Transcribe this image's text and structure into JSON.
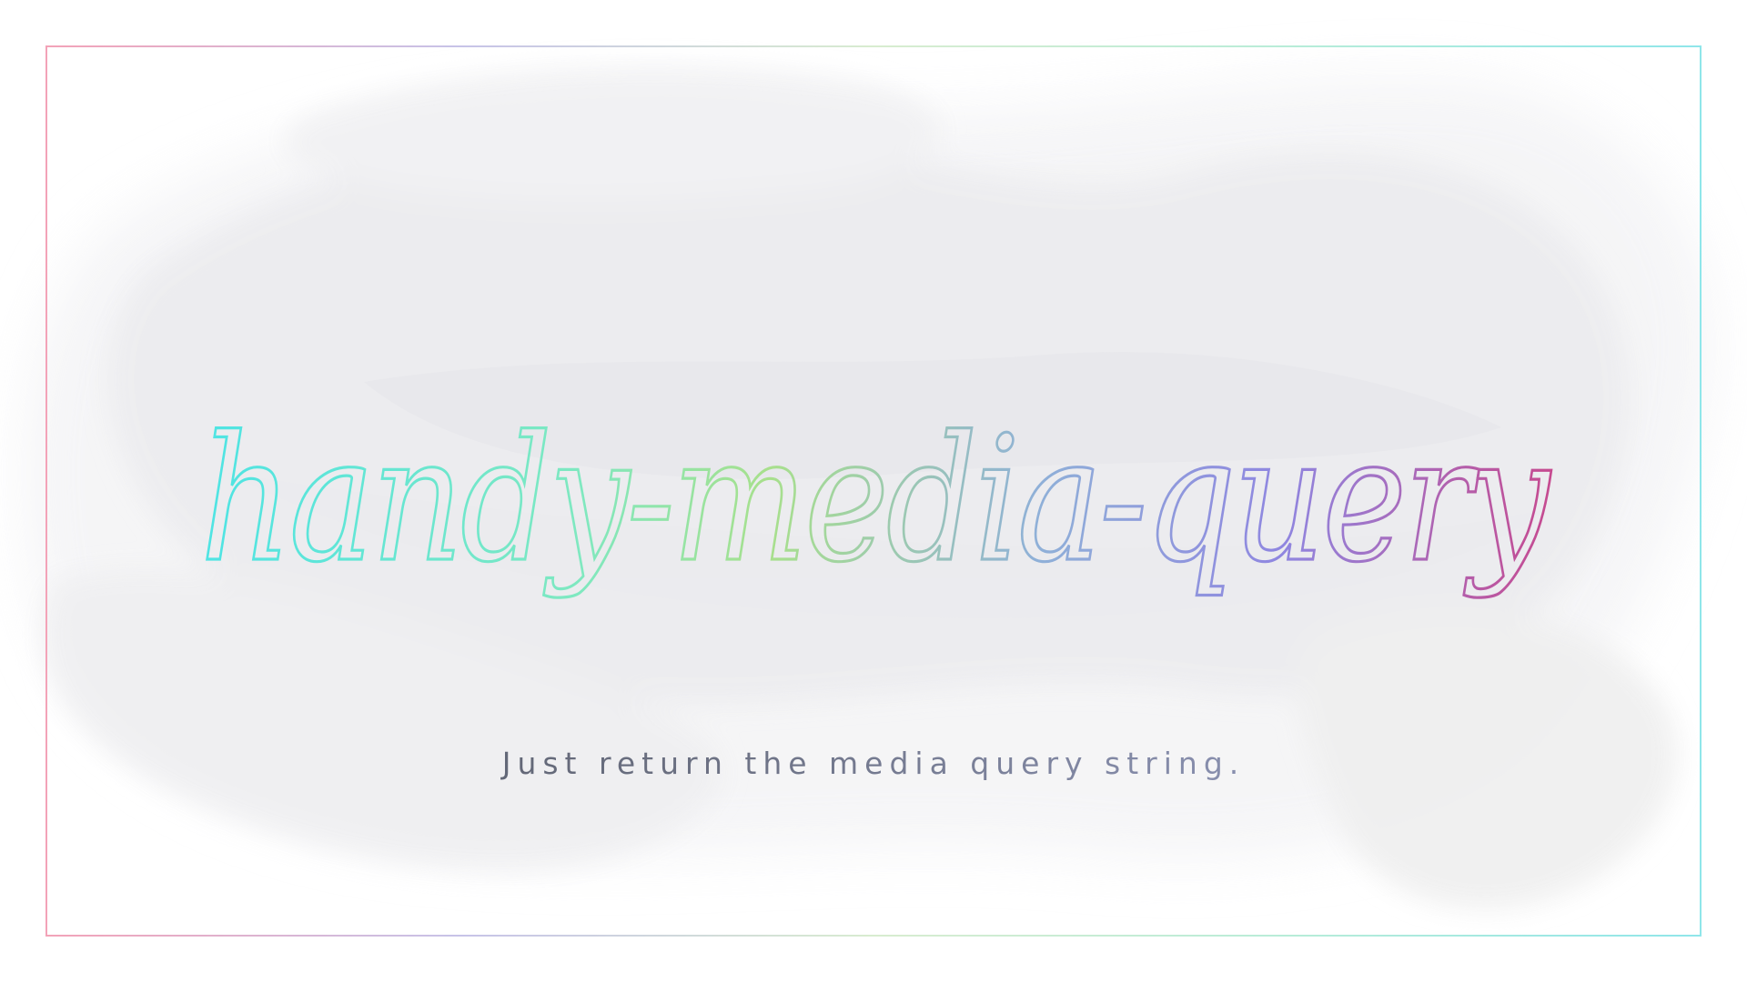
{
  "logo": {
    "text": "handy-media-query",
    "gradient": [
      "#4ee4e4",
      "#7fe8c0",
      "#a8e08c",
      "#8fb0d8",
      "#8f86e0",
      "#c64a90"
    ]
  },
  "tagline": {
    "text": "Just return the media query string."
  },
  "colors": {
    "background": "#ffffff",
    "watercolor": "#e9e9ec",
    "frame_left": "#f3a3b8",
    "frame_right": "#8fe6ea",
    "tagline_start": "#4e525c",
    "tagline_end": "#9aa0bf"
  }
}
